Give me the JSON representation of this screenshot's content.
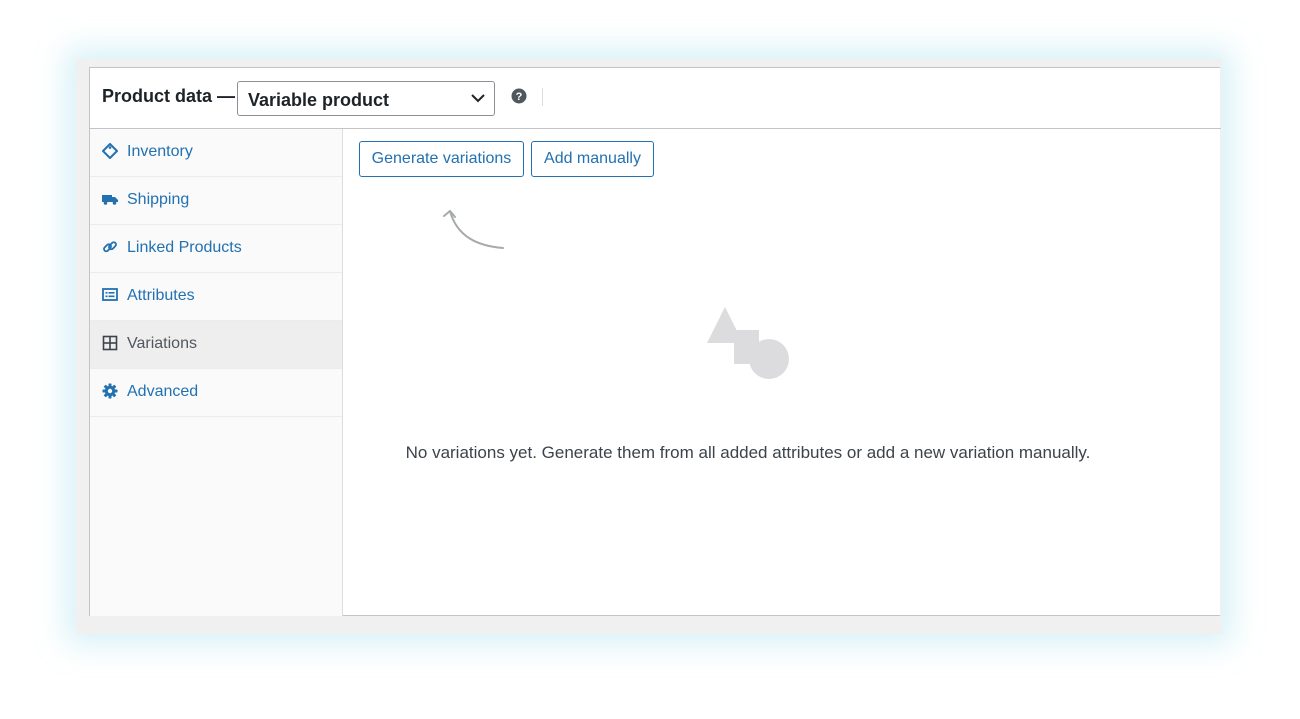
{
  "header": {
    "title": "Product data —",
    "product_type": {
      "selected": "Variable product"
    },
    "help_icon": "question-circle-icon"
  },
  "sidebar": {
    "items": [
      {
        "label": "Inventory",
        "icon": "tag-icon",
        "active": false
      },
      {
        "label": "Shipping",
        "icon": "truck-icon",
        "active": false
      },
      {
        "label": "Linked Products",
        "icon": "link-icon",
        "active": false
      },
      {
        "label": "Attributes",
        "icon": "list-view-icon",
        "active": false
      },
      {
        "label": "Variations",
        "icon": "grid-icon",
        "active": true
      },
      {
        "label": "Advanced",
        "icon": "gear-icon",
        "active": false
      }
    ]
  },
  "main": {
    "generate_label": "Generate variations",
    "add_manually_label": "Add manually",
    "empty_message": "No variations yet. Generate them from all added attributes or add a new variation manually.",
    "illustration": "shapes-icon"
  },
  "colors": {
    "link": "#2271b1",
    "text": "#1d2327",
    "muted": "#50575e",
    "illustration": "#dcdcde",
    "glow": "#8cd6e8"
  }
}
